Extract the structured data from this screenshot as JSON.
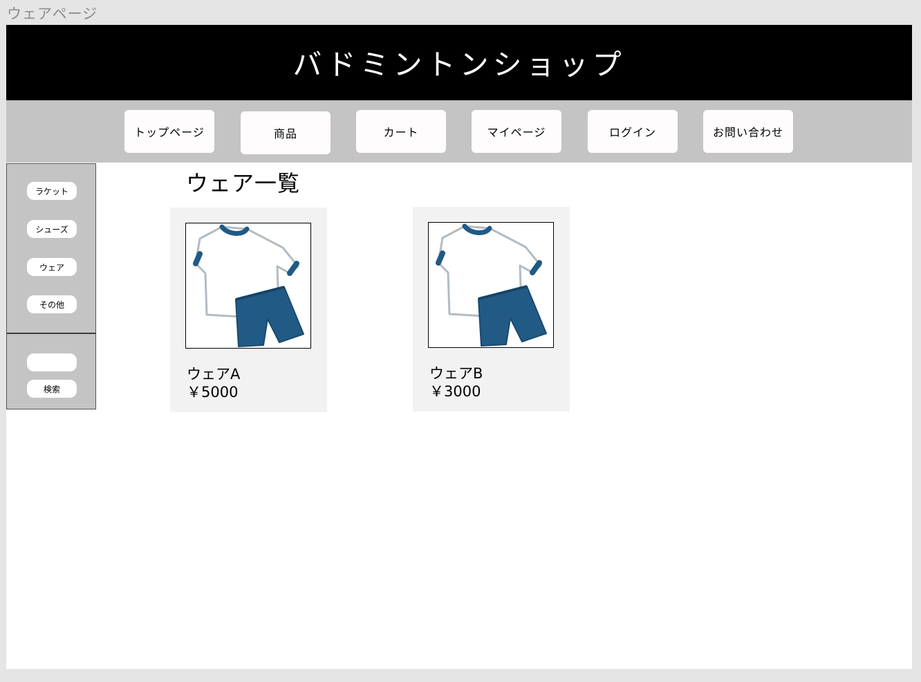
{
  "frame_label": "ウェアページ",
  "header": {
    "title": "バドミントンショップ"
  },
  "nav": {
    "items": [
      {
        "label": "トップページ"
      },
      {
        "label": "商品"
      },
      {
        "label": "カート"
      },
      {
        "label": "マイページ"
      },
      {
        "label": "ログイン"
      },
      {
        "label": "お問い合わせ"
      }
    ]
  },
  "sidebar": {
    "categories": [
      {
        "label": "ラケット"
      },
      {
        "label": "シューズ"
      },
      {
        "label": "ウェア"
      },
      {
        "label": "その他"
      }
    ],
    "search": {
      "value": "",
      "button_label": "検索"
    }
  },
  "main": {
    "heading": "ウェア一覧",
    "products": [
      {
        "name": "ウェアA",
        "price": "￥5000",
        "image_icon": "wear-set-icon"
      },
      {
        "name": "ウェアB",
        "price": "￥3000",
        "image_icon": "wear-set-icon"
      }
    ]
  },
  "colors": {
    "header_bg": "#000000",
    "nav_bg": "#c4c4c4",
    "card_bg": "#f2f2f2",
    "shirt_trim": "#1f5a86",
    "shorts": "#215b85"
  }
}
